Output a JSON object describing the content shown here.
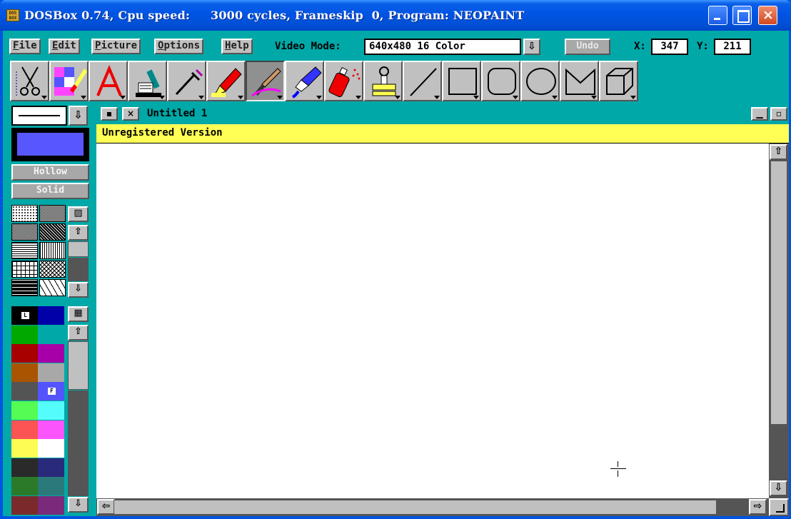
{
  "window": {
    "title": "DOSBox 0.74, Cpu speed:     3000 cycles, Frameskip  0, Program: NEOPAINT",
    "app_icon_text": "DOS BOX"
  },
  "menu": {
    "items": [
      {
        "label": "File"
      },
      {
        "label": "Edit"
      },
      {
        "label": "Picture"
      },
      {
        "label": "Options"
      },
      {
        "label": "Help"
      }
    ]
  },
  "video_mode": {
    "label": "Video Mode:",
    "value": "640x480 16 Color"
  },
  "undo_label": "Undo",
  "coords": {
    "x_label": "X:",
    "x_value": "347",
    "y_label": "Y:",
    "y_value": "211"
  },
  "tools": [
    {
      "name": "scissors-tool"
    },
    {
      "name": "color-brush-tool"
    },
    {
      "name": "text-tool"
    },
    {
      "name": "microscope-tool"
    },
    {
      "name": "dropper-tool"
    },
    {
      "name": "marker-tool"
    },
    {
      "name": "brush-tool",
      "pressed": true
    },
    {
      "name": "fill-tube-tool"
    },
    {
      "name": "spray-can-tool"
    },
    {
      "name": "stamp-tool"
    },
    {
      "name": "line-tool"
    },
    {
      "name": "rectangle-tool"
    },
    {
      "name": "rounded-rectangle-tool"
    },
    {
      "name": "ellipse-tool"
    },
    {
      "name": "polygon-tool"
    },
    {
      "name": "cube-tool"
    }
  ],
  "fill": {
    "hollow_label": "Hollow",
    "solid_label": "Solid"
  },
  "current_color": "#5757ff",
  "palette": [
    {
      "color": "#000000",
      "mark": "L"
    },
    {
      "color": "#0000a8",
      "mark": ""
    },
    {
      "color": "#00a800",
      "mark": ""
    },
    {
      "color": "#00a8a8",
      "mark": ""
    },
    {
      "color": "#a80000",
      "mark": ""
    },
    {
      "color": "#a800a8",
      "mark": ""
    },
    {
      "color": "#a85400",
      "mark": ""
    },
    {
      "color": "#a8a8a8",
      "mark": ""
    },
    {
      "color": "#545454",
      "mark": ""
    },
    {
      "color": "#5454fc",
      "mark": "F"
    },
    {
      "color": "#54fc54",
      "mark": ""
    },
    {
      "color": "#54fcfc",
      "mark": ""
    },
    {
      "color": "#fc5454",
      "mark": ""
    },
    {
      "color": "#fc54fc",
      "mark": ""
    },
    {
      "color": "#fcfc54",
      "mark": ""
    },
    {
      "color": "#ffffff",
      "mark": ""
    },
    {
      "color": "#2a2a2a",
      "mark": ""
    },
    {
      "color": "#2a2a7a",
      "mark": ""
    },
    {
      "color": "#2a7a2a",
      "mark": ""
    },
    {
      "color": "#2a7a7a",
      "mark": ""
    },
    {
      "color": "#7a2a2a",
      "mark": ""
    },
    {
      "color": "#7a2a7a",
      "mark": ""
    }
  ],
  "document": {
    "title": "Untitled 1",
    "notice": "Unregistered Version"
  }
}
